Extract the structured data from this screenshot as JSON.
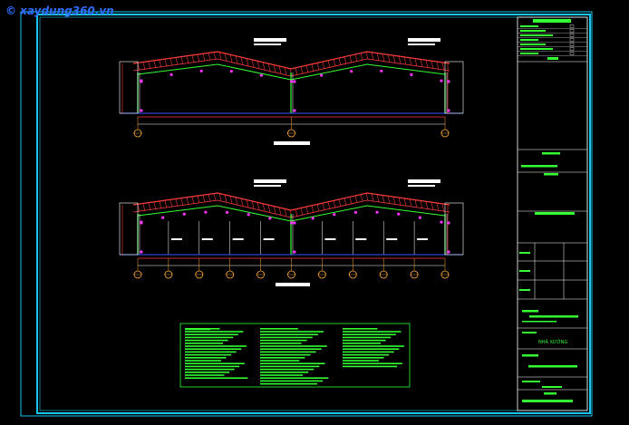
{
  "watermark": {
    "text": "© xaydung360.vn"
  },
  "title_block": {
    "project_name": "NHÀ XƯỞNG"
  },
  "colors": {
    "background": "#000000",
    "border_cyan": "#17c6f0",
    "frame_white": "#ffffff",
    "roof_red": "#ff3b3b",
    "purlin_green": "#33ff33",
    "node_magenta": "#ff33ff",
    "floor_blue": "#3355ff",
    "axis_orange": "#ffaa33",
    "text_green": "#33ff33"
  }
}
